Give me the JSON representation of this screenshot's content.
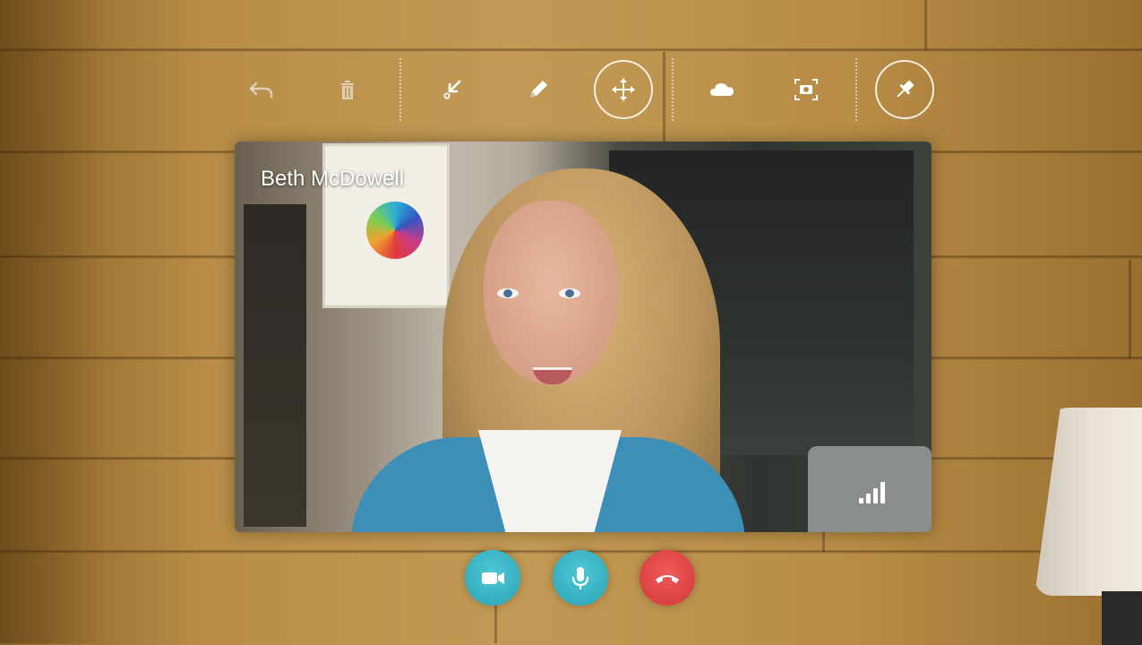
{
  "toolbar": {
    "buttons": [
      {
        "name": "undo",
        "icon": "undo-icon"
      },
      {
        "name": "delete",
        "icon": "trash-icon"
      },
      {
        "name": "arrow",
        "icon": "arrow-pointer-icon"
      },
      {
        "name": "pen",
        "icon": "pencil-icon"
      },
      {
        "name": "move",
        "icon": "move-arrows-icon",
        "active": true
      },
      {
        "name": "onedrive",
        "icon": "cloud-icon"
      },
      {
        "name": "snapshot",
        "icon": "camera-capture-icon"
      },
      {
        "name": "pin",
        "icon": "pushpin-icon"
      }
    ]
  },
  "call": {
    "caller_name": "Beth McDowell",
    "signal_strength_bars": 4
  },
  "controls": {
    "video": {
      "icon": "video-camera-icon",
      "color": "#2aa3b6"
    },
    "mic": {
      "icon": "microphone-icon",
      "color": "#2aa3b6"
    },
    "end_call": {
      "icon": "hang-up-icon",
      "color": "#d33838"
    }
  }
}
